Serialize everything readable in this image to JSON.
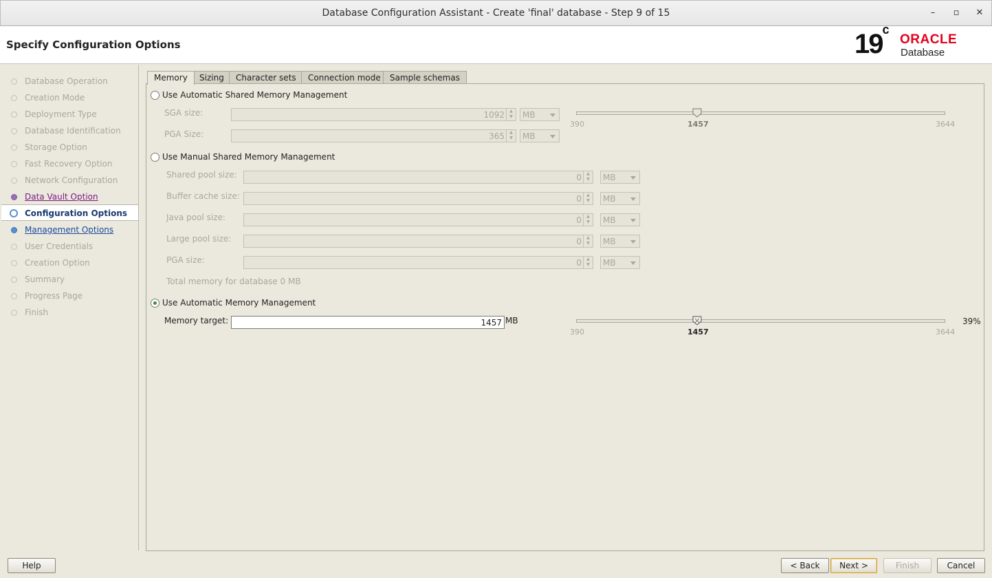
{
  "window": {
    "title": "Database Configuration Assistant - Create 'final' database - Step 9 of 15",
    "controls": [
      "minimize-icon",
      "maximize-icon",
      "close-icon"
    ]
  },
  "header": {
    "page_title": "Specify Configuration Options",
    "logo": {
      "version": "19",
      "version_sup": "c",
      "brand": "ORACLE",
      "product": "Database"
    }
  },
  "sidebar": {
    "steps": [
      {
        "label": "Database Operation",
        "state": "done"
      },
      {
        "label": "Creation Mode",
        "state": "done"
      },
      {
        "label": "Deployment Type",
        "state": "done"
      },
      {
        "label": "Database Identification",
        "state": "done"
      },
      {
        "label": "Storage Option",
        "state": "done"
      },
      {
        "label": "Fast Recovery Option",
        "state": "done"
      },
      {
        "label": "Network Configuration",
        "state": "done"
      },
      {
        "label": "Data Vault Option",
        "state": "visited"
      },
      {
        "label": "Configuration Options",
        "state": "current"
      },
      {
        "label": "Management Options",
        "state": "link"
      },
      {
        "label": "User Credentials",
        "state": "pending"
      },
      {
        "label": "Creation Option",
        "state": "pending"
      },
      {
        "label": "Summary",
        "state": "pending"
      },
      {
        "label": "Progress Page",
        "state": "pending"
      },
      {
        "label": "Finish",
        "state": "pending"
      }
    ]
  },
  "tabs": [
    {
      "label": "Memory",
      "active": true
    },
    {
      "label": "Sizing",
      "active": false
    },
    {
      "label": "Character sets",
      "active": false
    },
    {
      "label": "Connection mode",
      "active": false
    },
    {
      "label": "Sample schemas",
      "active": false
    }
  ],
  "memory": {
    "asmm": {
      "label": "Use Automatic Shared Memory Management",
      "selected": false,
      "sga_label": "SGA size:",
      "sga_value": "1092",
      "sga_unit": "MB",
      "pga_label": "PGA Size:",
      "pga_value": "365",
      "pga_unit": "MB",
      "slider": {
        "min": "390",
        "max": "3644",
        "value": "1457",
        "fraction": 0.328
      }
    },
    "manual": {
      "label": "Use Manual Shared Memory Management",
      "selected": false,
      "fields": [
        {
          "label": "Shared pool size:",
          "value": "0",
          "unit": "MB"
        },
        {
          "label": "Buffer cache size:",
          "value": "0",
          "unit": "MB"
        },
        {
          "label": "Java pool size:",
          "value": "0",
          "unit": "MB"
        },
        {
          "label": "Large pool size:",
          "value": "0",
          "unit": "MB"
        },
        {
          "label": "PGA size:",
          "value": "0",
          "unit": "MB"
        }
      ],
      "total": "Total memory for database 0 MB"
    },
    "amm": {
      "label": "Use Automatic Memory Management",
      "selected": true,
      "target_label": "Memory target:",
      "target_value": "1457",
      "target_unit": "MB",
      "slider": {
        "min": "390",
        "max": "3644",
        "value": "1457",
        "percent": "39%",
        "fraction": 0.328
      }
    }
  },
  "footer": {
    "help": "Help",
    "back": "< Back",
    "next": "Next >",
    "finish": "Finish",
    "cancel": "Cancel"
  }
}
